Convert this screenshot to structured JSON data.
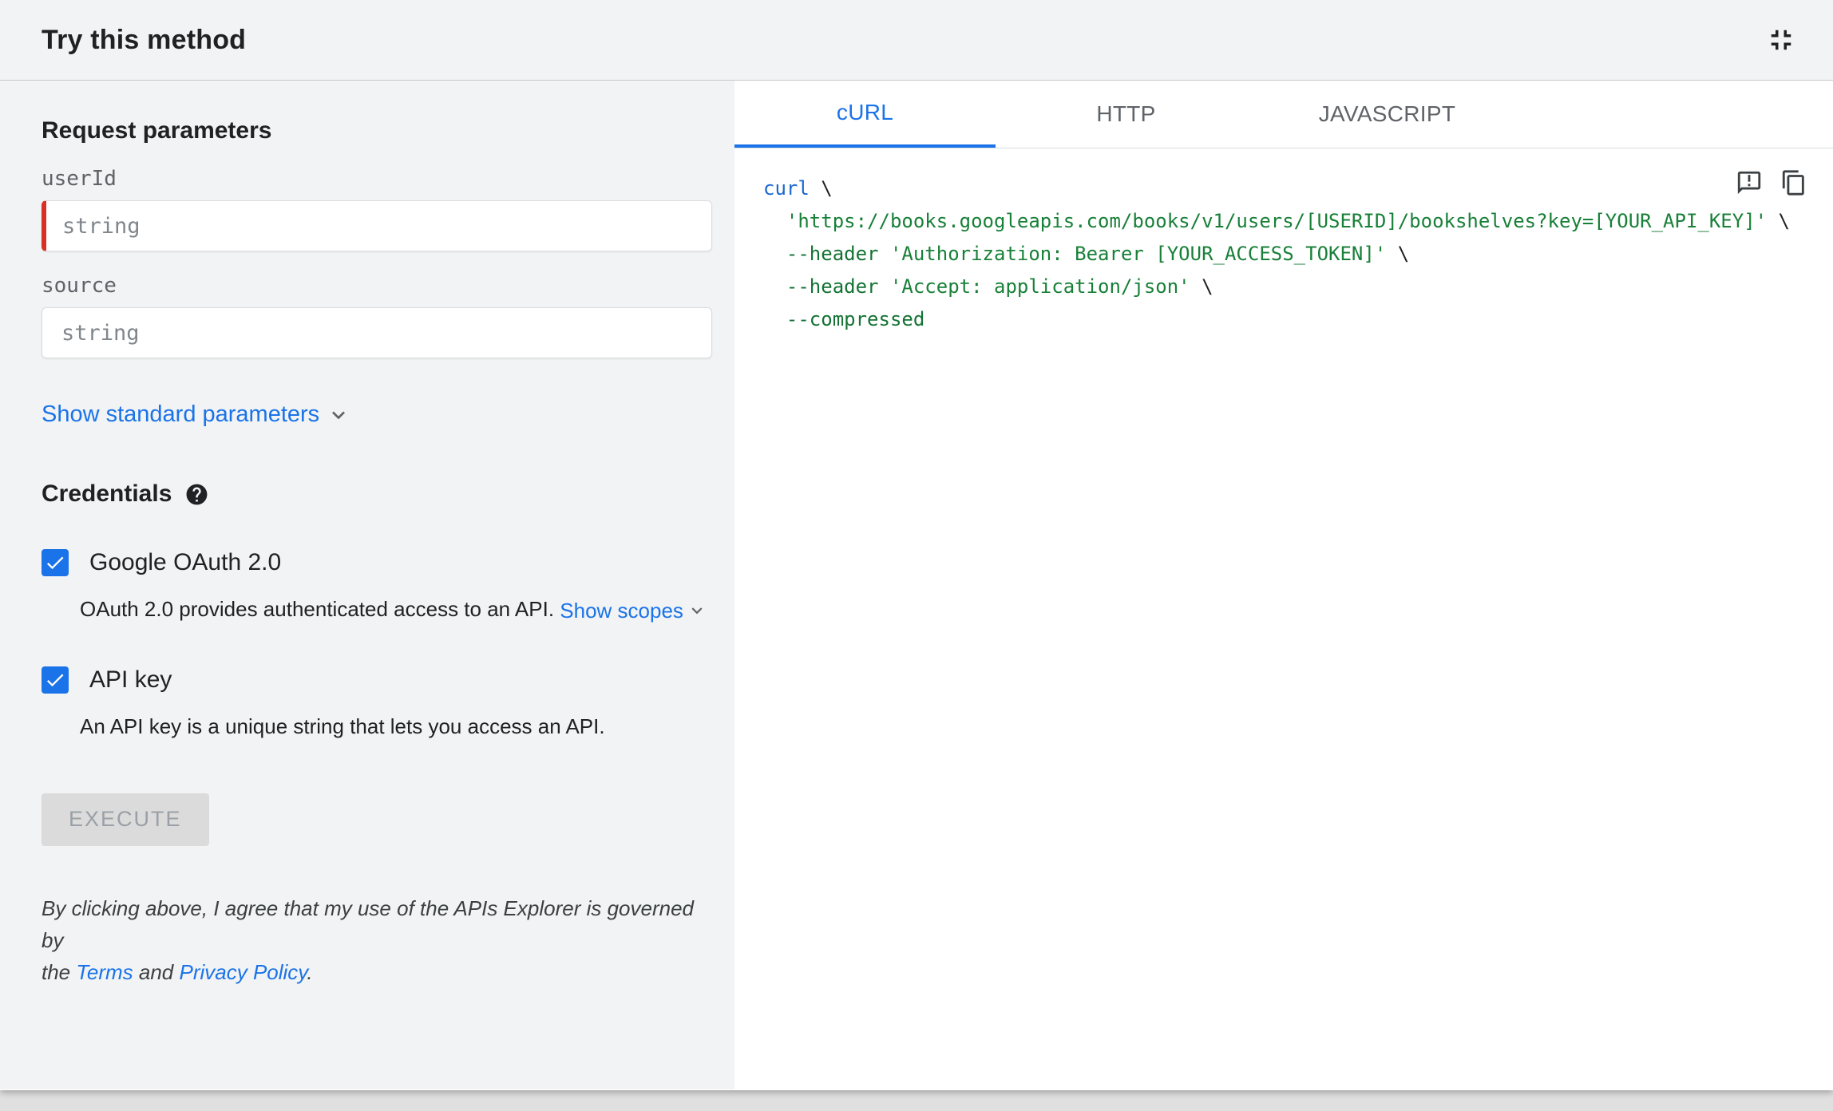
{
  "header": {
    "title": "Try this method"
  },
  "left": {
    "request_title": "Request parameters",
    "fields": [
      {
        "name": "userId",
        "placeholder": "string",
        "required": true
      },
      {
        "name": "source",
        "placeholder": "string",
        "required": false
      }
    ],
    "show_standard_params": "Show standard parameters",
    "credentials_title": "Credentials",
    "oauth_label": "Google OAuth 2.0",
    "oauth_checked": true,
    "oauth_desc": "OAuth 2.0 provides authenticated access to an API. ",
    "show_scopes": "Show scopes",
    "apikey_label": "API key",
    "apikey_checked": true,
    "apikey_desc": "An API key is a unique string that lets you access an API.",
    "execute_label": "EXECUTE",
    "disclaimer_line1": "By clicking above, I agree that my use of the APIs Explorer is governed by",
    "disclaimer_line2_pre": "the ",
    "terms_link": "Terms",
    "disclaimer_mid": " and ",
    "privacy_link": "Privacy Policy",
    "disclaimer_end": "."
  },
  "code_panel": {
    "tabs": [
      {
        "label": "cURL",
        "active": true
      },
      {
        "label": "HTTP",
        "active": false
      },
      {
        "label": "JAVASCRIPT",
        "active": false
      }
    ],
    "lines": [
      {
        "tokens": [
          {
            "text": "curl",
            "type": "kw"
          },
          {
            "text": " \\",
            "type": "pln"
          }
        ]
      },
      {
        "tokens": [
          {
            "text": "  ",
            "type": "pln"
          },
          {
            "text": "'https://books.googleapis.com/books/v1/users/[USERID]/bookshelves?key=[YOUR_API_KEY]'",
            "type": "str"
          },
          {
            "text": " \\",
            "type": "pln"
          }
        ]
      },
      {
        "tokens": [
          {
            "text": "  ",
            "type": "pln"
          },
          {
            "text": "--header",
            "type": "flag"
          },
          {
            "text": " ",
            "type": "pln"
          },
          {
            "text": "'Authorization: Bearer [YOUR_ACCESS_TOKEN]'",
            "type": "str"
          },
          {
            "text": " \\",
            "type": "pln"
          }
        ]
      },
      {
        "tokens": [
          {
            "text": "  ",
            "type": "pln"
          },
          {
            "text": "--header",
            "type": "flag"
          },
          {
            "text": " ",
            "type": "pln"
          },
          {
            "text": "'Accept: application/json'",
            "type": "str"
          },
          {
            "text": " \\",
            "type": "pln"
          }
        ]
      },
      {
        "tokens": [
          {
            "text": "  ",
            "type": "pln"
          },
          {
            "text": "--compressed",
            "type": "flag"
          }
        ]
      }
    ]
  },
  "colors": {
    "accent_blue": "#1a73e8",
    "required_red": "#d93025",
    "keyword_blue": "#1967d2",
    "string_green": "#188038",
    "flag_green": "#137333",
    "panel_gray": "#f1f3f4"
  }
}
